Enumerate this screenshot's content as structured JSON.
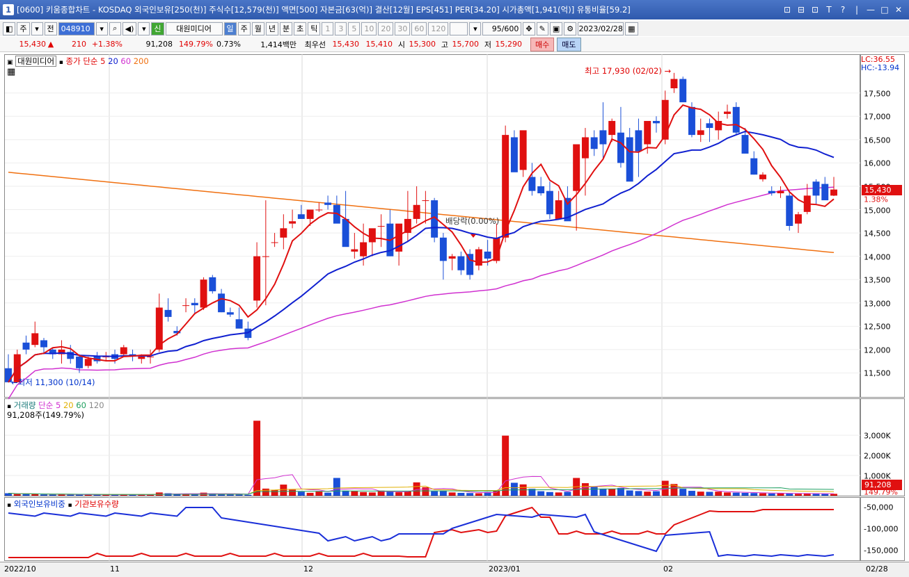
{
  "window": {
    "number": "1",
    "title": "[0600] 키움종합차트 - KOSDAQ 외국인보유[250(천)] 주식수[12,579(천)] 액면[500] 자본금[63(억)] 결산[12월] EPS[451] PER[34.20] 시가총액[1,941(억)] 유통비율[59.2]",
    "controls": [
      "⊡",
      "⊟",
      "⊡",
      "T",
      "?",
      "|",
      "—",
      "□",
      "✕"
    ]
  },
  "toolbar": {
    "market": "주",
    "prev_label": "전",
    "code_value": "048910",
    "news_badge": "신",
    "stock_name": "대원미디어",
    "periods": [
      "일",
      "주",
      "월",
      "년",
      "분",
      "초",
      "틱"
    ],
    "active_period": "일",
    "intervals": [
      "1",
      "3",
      "5",
      "10",
      "20",
      "30",
      "60",
      "120"
    ],
    "count": "95/600",
    "date": "2023/02/28"
  },
  "quote": {
    "price": "15,430",
    "arrow": "▲",
    "change": "210",
    "change_pct": "+1.38%",
    "volume": "91,208",
    "volume_pct": "149.79%",
    "turnover": "0.73%",
    "amount": "1,414백만",
    "best_label": "최우선",
    "ask": "15,430",
    "bid": "15,410",
    "open_label": "시",
    "open": "15,300",
    "high_label": "고",
    "high": "15,700",
    "low_label": "저",
    "low": "15,290",
    "buy_label": "매수",
    "sell_label": "매도"
  },
  "price_panel": {
    "legend_name": "대원미디어",
    "legend_ma": "종가 단순",
    "ma_periods": [
      "5",
      "20",
      "60",
      "200"
    ],
    "ma_colors": [
      "#e01010",
      "#1020d0",
      "#d030d0",
      "#f07010"
    ],
    "lc": "LC:36.55",
    "hc": "HC:-13.94",
    "y_ticks": [
      "17,500",
      "17,000",
      "16,500",
      "16,000",
      "15,500",
      "15,000",
      "14,500",
      "14,000",
      "13,500",
      "13,000",
      "12,500",
      "12,000",
      "11,500"
    ],
    "current_tag": "15,430",
    "current_pct": "1.38%",
    "high_annot": "최고 17,930 (02/02)",
    "low_annot": "최저 11,300 (10/14)",
    "dividend_annot": "배당락(0.00%)",
    "ylim": [
      11000,
      18300
    ]
  },
  "volume_panel": {
    "legend": "거래량",
    "legend_ma": "단순",
    "ma_periods": [
      "5",
      "20",
      "60",
      "120"
    ],
    "ma_colors": [
      "#d030d0",
      "#e0b000",
      "#20a060",
      "#888888"
    ],
    "sub": "91,208주(149.79%)",
    "y_ticks": [
      "3,000K",
      "2,000K",
      "1,000K"
    ],
    "current_tag": "91,208",
    "current_pct": "149.79%"
  },
  "foreign_panel": {
    "legend_a": "외국인보유비중",
    "legend_b": "기관보유수량",
    "y_ticks": [
      "-50,000",
      "-100,000",
      "-150,000"
    ]
  },
  "x_labels": [
    "2022/10",
    "11",
    "12",
    "2023/01",
    "02",
    "02/28"
  ],
  "chart_data": {
    "type": "candlestick",
    "ohlc": [
      [
        11600,
        11900,
        11300,
        11300
      ],
      [
        11300,
        12000,
        11300,
        11900
      ],
      [
        12150,
        12300,
        11900,
        12000
      ],
      [
        12100,
        12600,
        12050,
        12350
      ],
      [
        12200,
        12250,
        11900,
        12050
      ],
      [
        12000,
        12050,
        11800,
        11900
      ],
      [
        11900,
        12200,
        11700,
        12000
      ],
      [
        11950,
        12100,
        11700,
        11800
      ],
      [
        11850,
        11900,
        11500,
        11600
      ],
      [
        11650,
        11850,
        11600,
        11800
      ],
      [
        11850,
        11950,
        11700,
        11750
      ],
      [
        11850,
        11950,
        11750,
        11850
      ],
      [
        11900,
        12000,
        11700,
        11800
      ],
      [
        11900,
        12100,
        11850,
        12050
      ],
      [
        11900,
        12000,
        11750,
        11850
      ],
      [
        11800,
        11900,
        11700,
        11850
      ],
      [
        11850,
        12000,
        11700,
        11850
      ],
      [
        12000,
        13200,
        11950,
        12900
      ],
      [
        12850,
        13100,
        12600,
        12700
      ],
      [
        12400,
        12500,
        12300,
        12350
      ],
      [
        12950,
        13100,
        12800,
        12950
      ],
      [
        13000,
        13100,
        12750,
        12950
      ],
      [
        12900,
        13550,
        12850,
        13500
      ],
      [
        13550,
        13600,
        13200,
        13250
      ],
      [
        13200,
        13300,
        12800,
        12800
      ],
      [
        12800,
        12900,
        12700,
        12750
      ],
      [
        12650,
        12900,
        12550,
        12450
      ],
      [
        12450,
        12600,
        12200,
        12250
      ],
      [
        13050,
        14300,
        12900,
        14000
      ],
      [
        14000,
        15200,
        12950,
        14000
      ],
      [
        14300,
        14500,
        14200,
        14300
      ],
      [
        14400,
        14900,
        14150,
        14600
      ],
      [
        14700,
        15000,
        14600,
        14750
      ],
      [
        14900,
        15100,
        14800,
        14800
      ],
      [
        14800,
        15000,
        14650,
        15000
      ],
      [
        15000,
        15150,
        14950,
        15000
      ],
      [
        15150,
        15300,
        15000,
        15100
      ],
      [
        15100,
        15300,
        14900,
        14700
      ],
      [
        14800,
        15400,
        14700,
        14200
      ],
      [
        14100,
        14500,
        13950,
        14150
      ],
      [
        14000,
        14700,
        13800,
        14300
      ],
      [
        14300,
        14500,
        14000,
        14600
      ],
      [
        14650,
        14900,
        14200,
        14650
      ],
      [
        14700,
        15000,
        14000,
        14000
      ],
      [
        14100,
        14600,
        13800,
        14700
      ],
      [
        14500,
        15400,
        14300,
        14800
      ],
      [
        14800,
        15500,
        14700,
        15100
      ],
      [
        15200,
        15400,
        14700,
        15200
      ],
      [
        15200,
        15250,
        14300,
        14400
      ],
      [
        14400,
        14500,
        13500,
        13900
      ],
      [
        13950,
        14050,
        13700,
        14000
      ],
      [
        14000,
        14100,
        13600,
        13700
      ],
      [
        14050,
        14150,
        13500,
        13600
      ],
      [
        13800,
        14200,
        13700,
        14150
      ],
      [
        14100,
        14350,
        13800,
        13950
      ],
      [
        13900,
        14700,
        13850,
        14400
      ],
      [
        14400,
        16800,
        14300,
        16600
      ],
      [
        16550,
        16700,
        15850,
        15800
      ],
      [
        15850,
        16600,
        15700,
        16700
      ],
      [
        15700,
        16000,
        15300,
        15400
      ],
      [
        15500,
        15700,
        15300,
        15350
      ],
      [
        15400,
        15600,
        14800,
        14900
      ],
      [
        14800,
        15400,
        14800,
        15200
      ],
      [
        15250,
        15500,
        14950,
        14750
      ],
      [
        15400,
        15800,
        14550,
        16400
      ],
      [
        16100,
        16750,
        15300,
        16550
      ],
      [
        16550,
        16700,
        16150,
        16300
      ],
      [
        16700,
        17300,
        16100,
        16400
      ],
      [
        16600,
        16950,
        16450,
        16900
      ],
      [
        16650,
        17200,
        15900,
        16000
      ],
      [
        16550,
        16750,
        16100,
        15600
      ],
      [
        16700,
        16950,
        15700,
        16250
      ],
      [
        16400,
        16800,
        16200,
        16900
      ],
      [
        16900,
        17000,
        16650,
        16850
      ],
      [
        16500,
        17550,
        16400,
        17350
      ],
      [
        17600,
        17930,
        17500,
        17800
      ],
      [
        17800,
        17850,
        17400,
        17300
      ],
      [
        17200,
        17300,
        16550,
        16600
      ],
      [
        16600,
        16950,
        16450,
        16700
      ],
      [
        16850,
        16950,
        16450,
        16750
      ],
      [
        16700,
        17100,
        16500,
        16900
      ],
      [
        17050,
        17250,
        16950,
        17100
      ],
      [
        17200,
        17300,
        16600,
        16650
      ],
      [
        16600,
        16750,
        16250,
        16200
      ],
      [
        16100,
        16250,
        15750,
        15750
      ],
      [
        15650,
        15800,
        15600,
        15750
      ],
      [
        15400,
        15500,
        15300,
        15350
      ],
      [
        15350,
        15500,
        15250,
        15400
      ],
      [
        15300,
        15400,
        14550,
        14650
      ],
      [
        14700,
        14950,
        14500,
        14900
      ],
      [
        14950,
        15550,
        14900,
        15300
      ],
      [
        15600,
        15650,
        15100,
        15300
      ],
      [
        15550,
        15700,
        15300,
        15200
      ],
      [
        15300,
        15700,
        15290,
        15430
      ]
    ],
    "volume_k": [
      120,
      80,
      90,
      70,
      60,
      50,
      55,
      60,
      50,
      45,
      40,
      45,
      50,
      60,
      50,
      45,
      40,
      160,
      120,
      60,
      80,
      70,
      150,
      110,
      80,
      60,
      50,
      45,
      3720,
      350,
      290,
      550,
      300,
      200,
      140,
      220,
      150,
      880,
      250,
      220,
      180,
      160,
      250,
      200,
      170,
      210,
      660,
      420,
      220,
      250,
      160,
      140,
      130,
      120,
      180,
      240,
      2980,
      640,
      560,
      340,
      220,
      180,
      160,
      190,
      880,
      620,
      430,
      350,
      330,
      380,
      260,
      230,
      200,
      220,
      740,
      580,
      340,
      240,
      200,
      190,
      200,
      160,
      150,
      140,
      130,
      120,
      110,
      120,
      100,
      95,
      110,
      100,
      90,
      91
    ]
  }
}
